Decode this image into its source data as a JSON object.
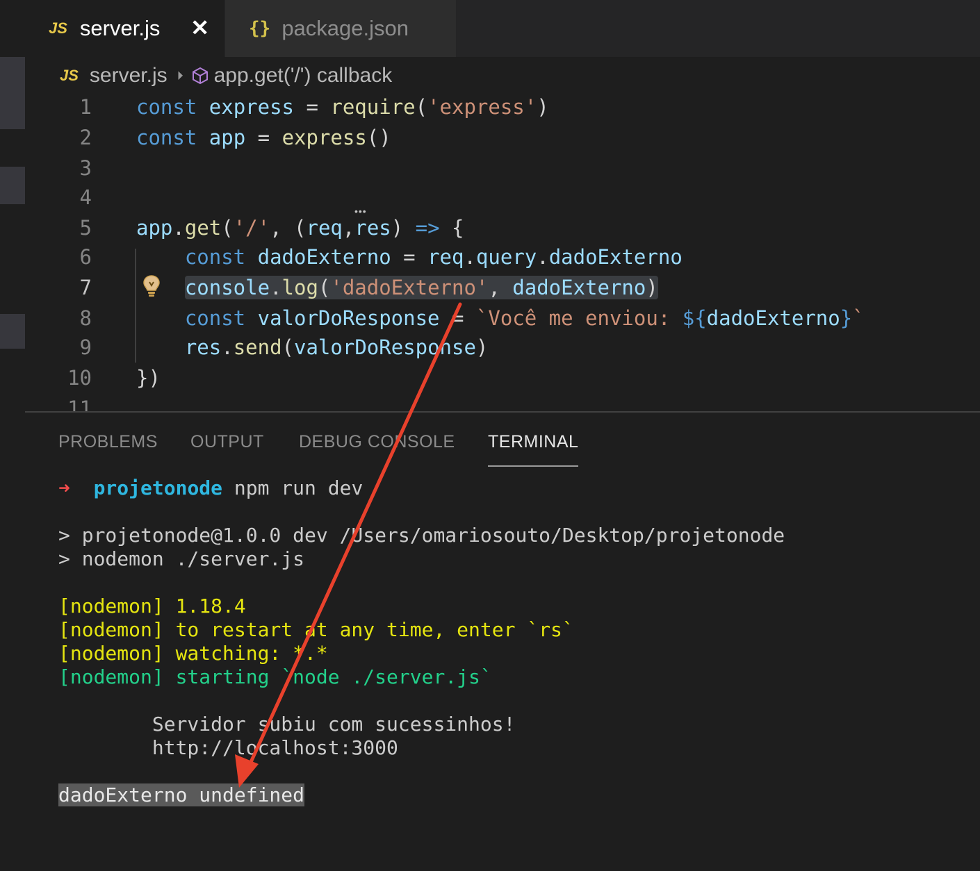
{
  "tabs": [
    {
      "badge": "JS",
      "label": "server.js",
      "close": "✕"
    },
    {
      "badge": "{}",
      "label": "package.json"
    }
  ],
  "breadcrumb": {
    "badge": "JS",
    "file": "server.js",
    "sep": "⏵",
    "symbol": "app.get('/') callback"
  },
  "editor": {
    "line_numbers": [
      "1",
      "2",
      "3",
      "4",
      "5",
      "6",
      "7",
      "8",
      "9",
      "10",
      "11"
    ],
    "current_line": "7"
  },
  "panel": {
    "tabs": [
      "PROBLEMS",
      "OUTPUT",
      "DEBUG CONSOLE",
      "TERMINAL"
    ],
    "active_tab": "TERMINAL"
  },
  "terminal": {
    "prompt_arrow": "➜",
    "prompt_dir": "projetonode",
    "prompt_cmd": " npm run dev",
    "line1": "> projetonode@1.0.0 dev /Users/omariosouto/Desktop/projetonode",
    "line2": "> nodemon ./server.js",
    "nodemon1": "[nodemon] 1.18.4",
    "nodemon2": "[nodemon] to restart at any time, enter `rs`",
    "nodemon3": "[nodemon] watching: *.*",
    "nodemon4": "[nodemon] starting `node ./server.js`",
    "server1": "        Servidor subiu com sucessinhos!",
    "server2": "        http://localhost:3000",
    "output": "dadoExterno undefined"
  },
  "colors": {
    "annotation_arrow": "#e8412c",
    "keyword": "#569cd6",
    "string": "#ce9178",
    "function": "#dcdcaa",
    "variable": "#9cdcfe"
  }
}
